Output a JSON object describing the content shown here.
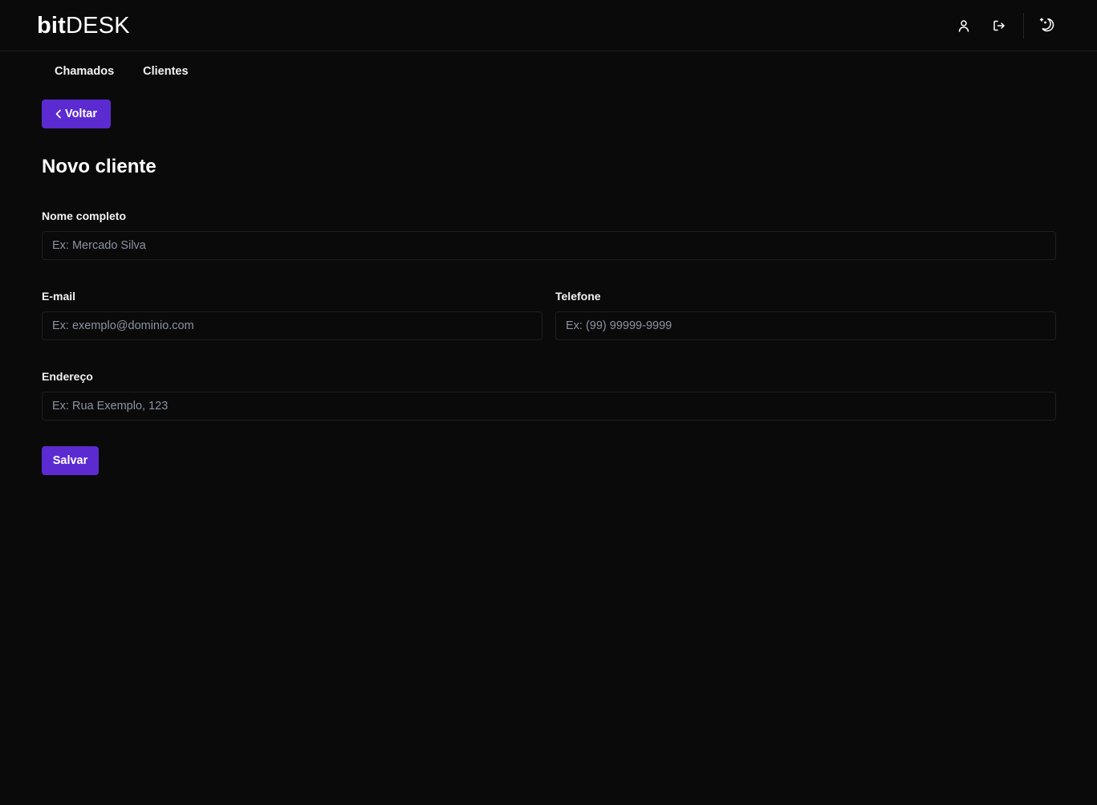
{
  "header": {
    "logo_bold": "bit",
    "logo_light": "DESK",
    "icons": [
      "user-icon",
      "logout-icon",
      "theme-toggle-icon"
    ]
  },
  "nav": {
    "items": [
      {
        "label": "Chamados"
      },
      {
        "label": "Clientes"
      }
    ]
  },
  "back_button": {
    "label": "Voltar",
    "icon": "chevron-left-icon"
  },
  "page": {
    "title": "Novo cliente"
  },
  "form": {
    "nome": {
      "label": "Nome completo",
      "placeholder": "Ex: Mercado Silva",
      "value": ""
    },
    "email": {
      "label": "E-mail",
      "placeholder": "Ex: exemplo@dominio.com",
      "value": ""
    },
    "telefone": {
      "label": "Telefone",
      "placeholder": "Ex: (99) 99999-9999",
      "value": ""
    },
    "endereco": {
      "label": "Endereço",
      "placeholder": "Ex: Rua Exemplo, 123",
      "value": ""
    },
    "save_label": "Salvar"
  },
  "colors": {
    "background": "#0a0a0a",
    "accent": "#5b2bd1",
    "border": "#1f1f1f",
    "placeholder": "#8b93a1"
  }
}
